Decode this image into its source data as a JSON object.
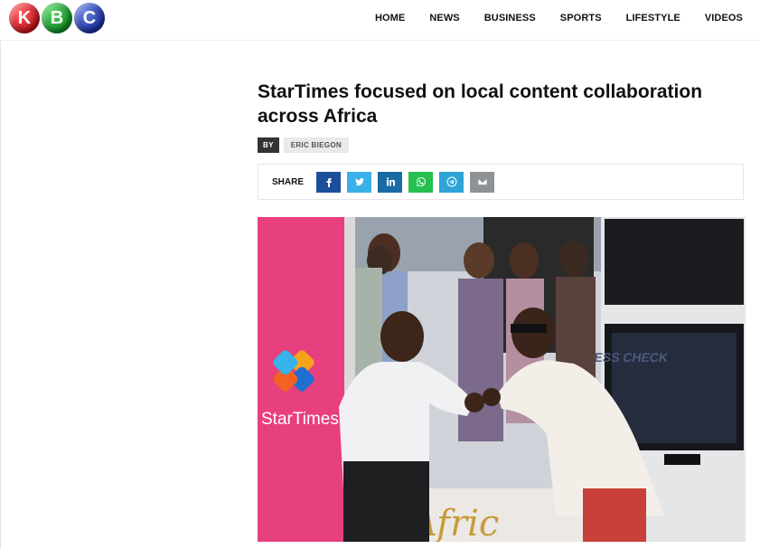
{
  "header": {
    "logo": {
      "letters": [
        "K",
        "B",
        "C"
      ]
    },
    "nav": [
      "HOME",
      "NEWS",
      "BUSINESS",
      "SPORTS",
      "LIFESTYLE",
      "VIDEOS"
    ]
  },
  "article": {
    "title": "StarTimes focused on local content collaboration across Africa",
    "by_label": "BY",
    "author": "ERIC BIEGON",
    "share_label": "SHARE",
    "share_buttons": [
      "facebook-icon",
      "twitter-icon",
      "linkedin-icon",
      "whatsapp-icon",
      "telegram-icon",
      "email-icon"
    ],
    "photo": {
      "banner_text": "StarTimes",
      "screen_text": "ESS CHECK",
      "bottom_text": "Afric"
    }
  },
  "colors": {
    "facebook": "#1d4e9a",
    "twitter": "#3bb0e8",
    "linkedin": "#1a6aa5",
    "whatsapp": "#25c04f",
    "telegram": "#2fa2d8",
    "email": "#8f9295",
    "banner_pink": "#e83f7f"
  }
}
